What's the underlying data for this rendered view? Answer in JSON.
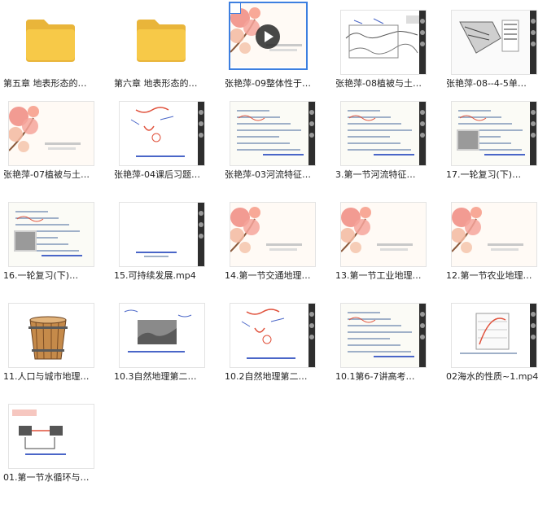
{
  "items": [
    {
      "label": "第五章 地表形态的…",
      "kind": "folder"
    },
    {
      "label": "第六章 地表形态的…",
      "kind": "folder"
    },
    {
      "label": "张艳萍-09整体性于…",
      "kind": "video-selected"
    },
    {
      "label": "张艳萍-08植被与土…",
      "kind": "map"
    },
    {
      "label": "张艳萍-08--4-5单…",
      "kind": "diagram"
    },
    {
      "label": "张艳萍-07植被与土…",
      "kind": "title-slide"
    },
    {
      "label": "张艳萍-04课后习题…",
      "kind": "handwriting"
    },
    {
      "label": "张艳萍-03河流特征…",
      "kind": "notes"
    },
    {
      "label": "3.第一节河流特征…",
      "kind": "notes"
    },
    {
      "label": "17.一轮复习(下)…",
      "kind": "notes-image"
    },
    {
      "label": "16.一轮复习(下)…",
      "kind": "notes-image"
    },
    {
      "label": "15.可持续发展.mp4",
      "kind": "blank"
    },
    {
      "label": "14.第一节交通地理…",
      "kind": "title-slide"
    },
    {
      "label": "13.第一节工业地理…",
      "kind": "title-slide"
    },
    {
      "label": "12.第一节农业地理…",
      "kind": "title-slide"
    },
    {
      "label": "11.人口与城市地理…",
      "kind": "bucket"
    },
    {
      "label": "10.3自然地理第二…",
      "kind": "photo-notes"
    },
    {
      "label": "10.2自然地理第二…",
      "kind": "handwriting"
    },
    {
      "label": "10.1第6-7讲高考…",
      "kind": "notes"
    },
    {
      "label": "02海水的性质~1.mp4",
      "kind": "chart"
    },
    {
      "label": "01.第一节水循环与…",
      "kind": "diagram-notes"
    }
  ],
  "thumb_texts": {
    "item3_title": "整体性和差异性",
    "item6_title": "植被与土壤",
    "item13_title": "交通地理",
    "item14_title": "工业地理",
    "item15_title": "农业地理",
    "item13_heading": "高新城市产业"
  },
  "colors": {
    "folder": "#f7c948",
    "folder_back": "#e9b53a",
    "selection": "#3d7fe0",
    "blossom": "#f08a80",
    "dark_bar": "#2e2e2e"
  }
}
